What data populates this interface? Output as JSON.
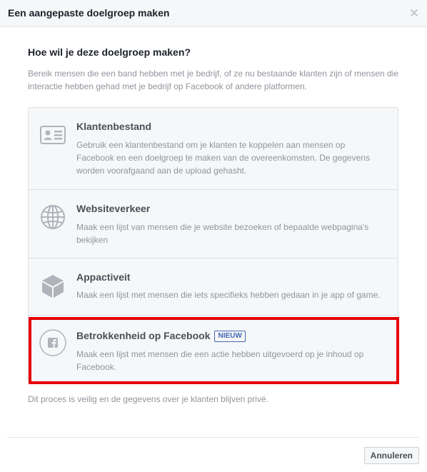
{
  "dialog": {
    "title": "Een aangepaste doelgroep maken",
    "close_icon": "close-icon"
  },
  "content": {
    "question": "Hoe wil je deze doelgroep maken?",
    "intro": "Bereik mensen die een band hebben met je bedrijf, of ze nu bestaande klanten zijn of mensen die interactie hebben gehad met je bedrijf op Facebook of andere platformen.",
    "options": [
      {
        "icon": "contact-card-icon",
        "title": "Klantenbestand",
        "description": "Gebruik een klantenbestand om je klanten te koppelen aan mensen op Facebook en een doelgroep te maken van de overeenkomsten. De gegevens worden voorafgaand aan de upload gehasht."
      },
      {
        "icon": "globe-icon",
        "title": "Websiteverkeer",
        "description": "Maak een lijst van mensen die je website bezoeken of bepaalde webpagina's bekijken"
      },
      {
        "icon": "cube-icon",
        "title": "Appactiveit",
        "description": "Maak een lijst met mensen die iets specifieks hebben gedaan in je app of game."
      },
      {
        "icon": "facebook-icon",
        "title": "Betrokkenheid op Facebook",
        "badge": "NIEUW",
        "description": "Maak een lijst met mensen die een actie hebben uitgevoerd op je inhoud op Facebook."
      }
    ],
    "privacy_note": "Dit proces is veilig en de gegevens over je klanten blijven privé."
  },
  "footer": {
    "cancel_label": "Annuleren"
  },
  "colors": {
    "highlight": "#e50000",
    "accent": "#4267b2"
  }
}
